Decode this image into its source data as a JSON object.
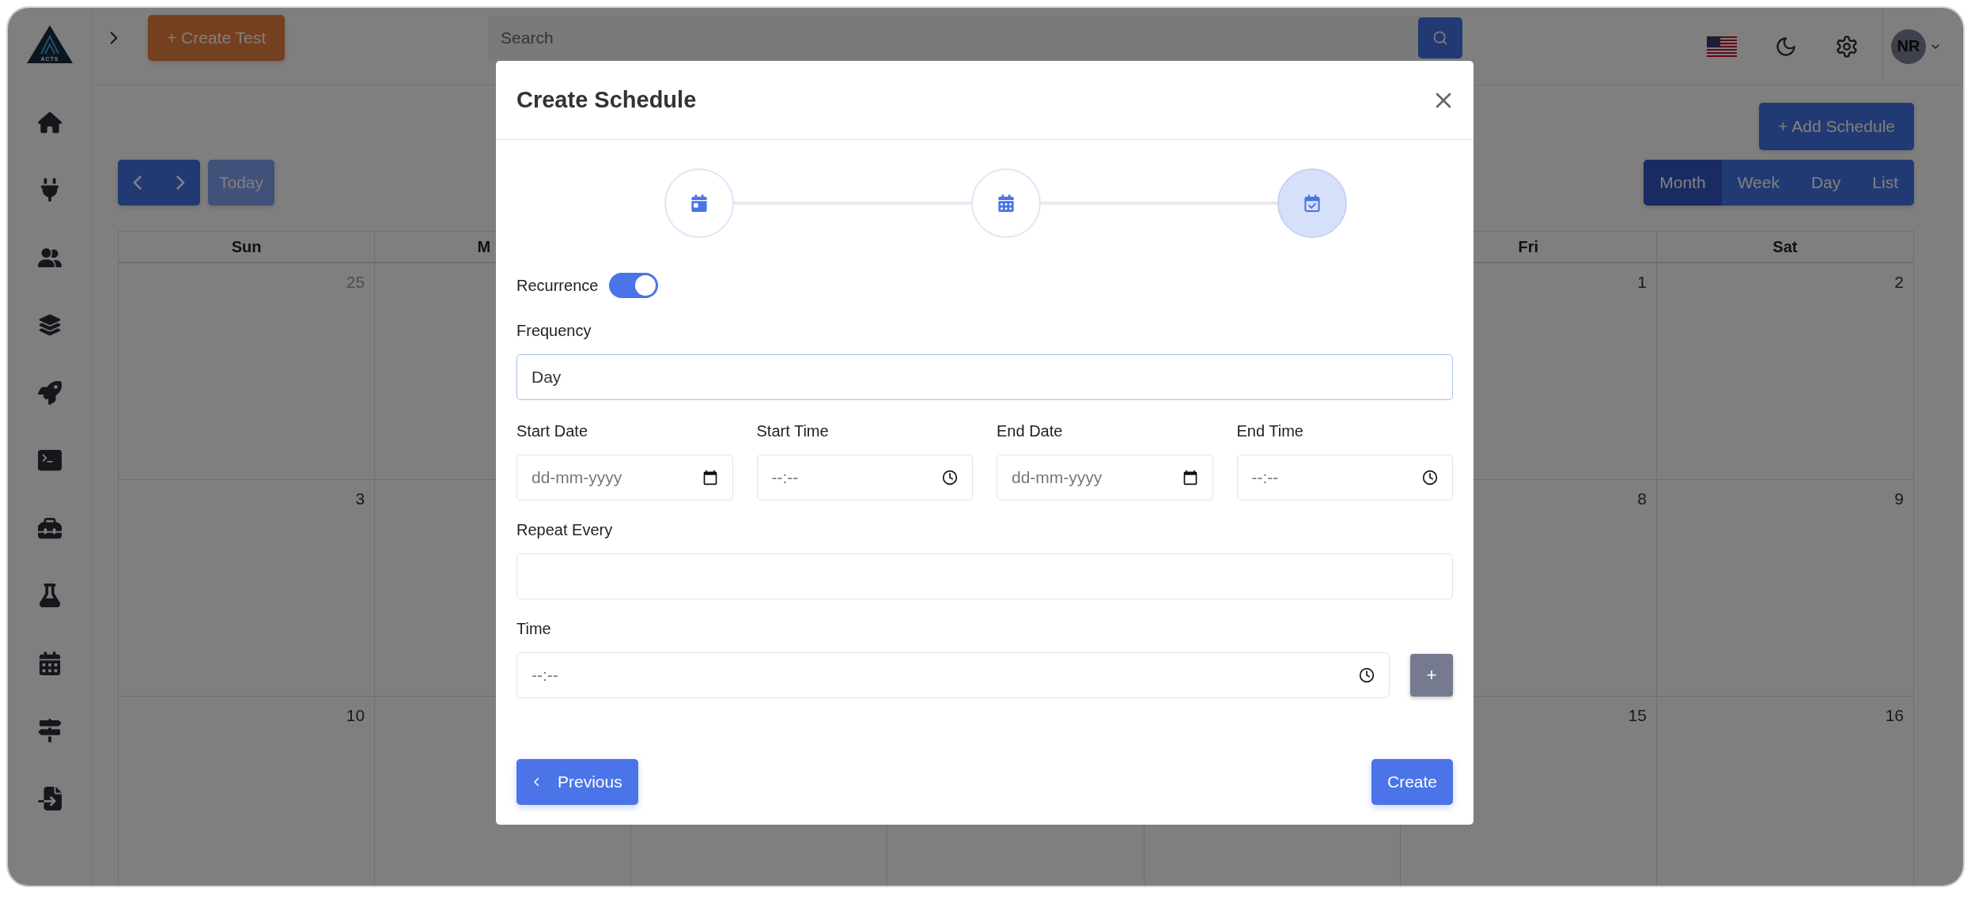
{
  "sidebar": {
    "logo": "ACTS"
  },
  "header": {
    "create_button": "+ Create Test",
    "search": {
      "placeholder": "Search"
    },
    "avatar": {
      "initials": "NR"
    }
  },
  "toolbar": {
    "add_button": "+ Add Schedule",
    "today_button": {
      "label": "Today",
      "disabled": true
    },
    "views": [
      {
        "label": "Month",
        "selected": true
      },
      {
        "label": "Week",
        "selected": false
      },
      {
        "label": "Day",
        "selected": false
      },
      {
        "label": "List",
        "selected": false
      }
    ]
  },
  "calendar": {
    "headers": [
      {
        "kind": "label",
        "label": "Sun"
      },
      {
        "kind": "partial",
        "label": "M"
      },
      {
        "kind": "covered"
      },
      {
        "kind": "covered"
      },
      {
        "kind": "covered"
      },
      {
        "kind": "label",
        "label": "Fri"
      },
      {
        "kind": "label",
        "label": "Sat"
      }
    ],
    "rows": [
      {
        "cells": [
          {
            "kind": "date",
            "day": "25",
            "outside_month": true
          },
          {
            "kind": "blank"
          },
          {
            "kind": "blank"
          },
          {
            "kind": "blank"
          },
          {
            "kind": "blank"
          },
          {
            "kind": "date",
            "day": "1",
            "outside_month": false
          },
          {
            "kind": "date",
            "day": "2",
            "outside_month": false
          }
        ]
      },
      {
        "cells": [
          {
            "kind": "date",
            "day": "3",
            "outside_month": false
          },
          {
            "kind": "blank"
          },
          {
            "kind": "blank"
          },
          {
            "kind": "blank"
          },
          {
            "kind": "blank"
          },
          {
            "kind": "date",
            "day": "8",
            "outside_month": false
          },
          {
            "kind": "date",
            "day": "9",
            "outside_month": false
          }
        ]
      },
      {
        "cells": [
          {
            "kind": "date",
            "day": "10",
            "outside_month": false
          },
          {
            "kind": "blank"
          },
          {
            "kind": "blank"
          },
          {
            "kind": "blank"
          },
          {
            "kind": "blank"
          },
          {
            "kind": "date",
            "day": "15",
            "outside_month": false
          },
          {
            "kind": "date",
            "day": "16",
            "outside_month": false
          }
        ]
      }
    ]
  },
  "modal": {
    "title": "Create Schedule",
    "steps": [
      {
        "selected": false
      },
      {
        "selected": false
      },
      {
        "selected": true
      }
    ],
    "recurrence": {
      "label": "Recurrence",
      "on": true
    },
    "frequency": {
      "label": "Frequency",
      "value": "Day",
      "focused": true
    },
    "range_fields": [
      {
        "label": "Start Date",
        "kind": "date",
        "placeholder": "dd-mm-yyyy"
      },
      {
        "label": "Start Time",
        "kind": "time",
        "placeholder": "--:--"
      },
      {
        "label": "End Date",
        "kind": "date",
        "placeholder": "dd-mm-yyyy"
      },
      {
        "label": "End Time",
        "kind": "time",
        "placeholder": "--:--"
      }
    ],
    "repeat_every": {
      "label": "Repeat Every"
    },
    "time": {
      "label": "Time",
      "placeholder": "--:--",
      "add_button": "+"
    },
    "previous_button": "Previous",
    "create_button": "Create"
  }
}
